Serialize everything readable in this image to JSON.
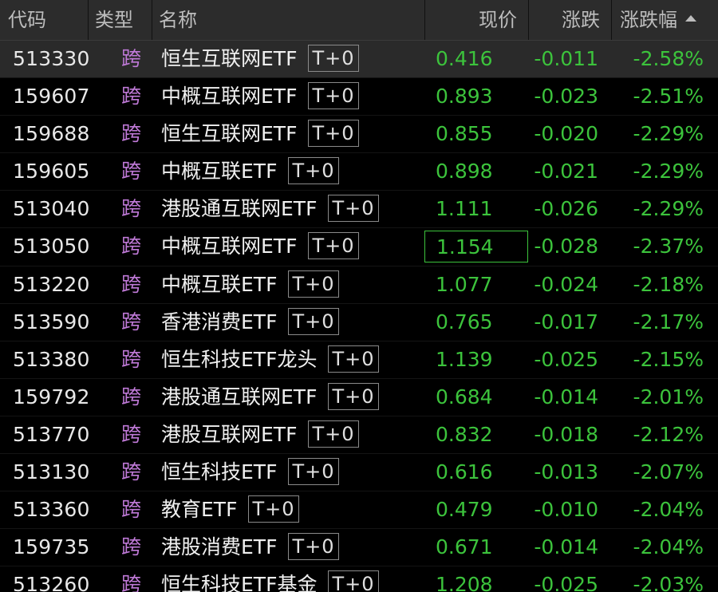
{
  "header": {
    "code": "代码",
    "type": "类型",
    "name": "名称",
    "price": "现价",
    "change": "涨跌",
    "pct": "涨跌幅",
    "sort_icon": "sort-ascending-triangle-icon"
  },
  "colors": {
    "background": "#000000",
    "header_bg": "#2c2c2c",
    "selected_row": "#2a2a2a",
    "down_green": "#3cc33c",
    "type_purple": "#c07ad8"
  },
  "rows": [
    {
      "code": "513330",
      "type": "跨",
      "name": "恒生互联网ETF",
      "tag": "T+0",
      "price": "0.416",
      "change": "-0.011",
      "pct": "-2.58%"
    },
    {
      "code": "159607",
      "type": "跨",
      "name": "中概互联网ETF",
      "tag": "T+0",
      "price": "0.893",
      "change": "-0.023",
      "pct": "-2.51%"
    },
    {
      "code": "159688",
      "type": "跨",
      "name": "恒生互联网ETF",
      "tag": "T+0",
      "price": "0.855",
      "change": "-0.020",
      "pct": "-2.29%"
    },
    {
      "code": "159605",
      "type": "跨",
      "name": "中概互联ETF",
      "tag": "T+0",
      "price": "0.898",
      "change": "-0.021",
      "pct": "-2.29%"
    },
    {
      "code": "513040",
      "type": "跨",
      "name": "港股通互联网ETF",
      "tag": "T+0",
      "price": "1.111",
      "change": "-0.026",
      "pct": "-2.29%"
    },
    {
      "code": "513050",
      "type": "跨",
      "name": "中概互联网ETF",
      "tag": "T+0",
      "price": "1.154",
      "change": "-0.028",
      "pct": "-2.37%"
    },
    {
      "code": "513220",
      "type": "跨",
      "name": "中概互联ETF",
      "tag": "T+0",
      "price": "1.077",
      "change": "-0.024",
      "pct": "-2.18%"
    },
    {
      "code": "513590",
      "type": "跨",
      "name": "香港消费ETF",
      "tag": "T+0",
      "price": "0.765",
      "change": "-0.017",
      "pct": "-2.17%"
    },
    {
      "code": "513380",
      "type": "跨",
      "name": "恒生科技ETF龙头",
      "tag": "T+0",
      "price": "1.139",
      "change": "-0.025",
      "pct": "-2.15%"
    },
    {
      "code": "159792",
      "type": "跨",
      "name": "港股通互联网ETF",
      "tag": "T+0",
      "price": "0.684",
      "change": "-0.014",
      "pct": "-2.01%"
    },
    {
      "code": "513770",
      "type": "跨",
      "name": "港股互联网ETF",
      "tag": "T+0",
      "price": "0.832",
      "change": "-0.018",
      "pct": "-2.12%"
    },
    {
      "code": "513130",
      "type": "跨",
      "name": "恒生科技ETF",
      "tag": "T+0",
      "price": "0.616",
      "change": "-0.013",
      "pct": "-2.07%"
    },
    {
      "code": "513360",
      "type": "跨",
      "name": "教育ETF",
      "tag": "T+0",
      "price": "0.479",
      "change": "-0.010",
      "pct": "-2.04%"
    },
    {
      "code": "159735",
      "type": "跨",
      "name": "港股消费ETF",
      "tag": "T+0",
      "price": "0.671",
      "change": "-0.014",
      "pct": "-2.04%"
    },
    {
      "code": "513260",
      "type": "跨",
      "name": "恒生科技ETF基金",
      "tag": "T+0",
      "price": "1.208",
      "change": "-0.025",
      "pct": "-2.03%"
    }
  ]
}
